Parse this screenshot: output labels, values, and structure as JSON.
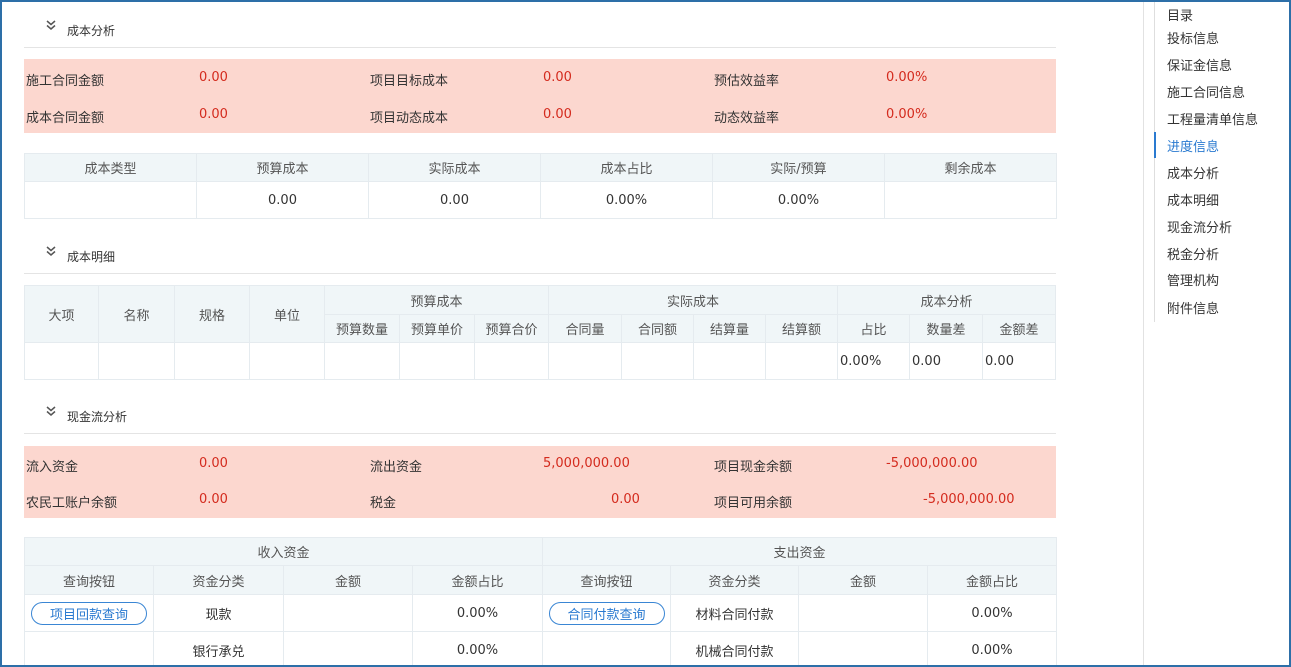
{
  "sections": {
    "cost_analysis": "成本分析",
    "cost_detail": "成本明细",
    "cash_flow": "现金流分析"
  },
  "cost_summary": {
    "row1": [
      {
        "label": "施工合同金额",
        "value": "0.00"
      },
      {
        "label": "项目目标成本",
        "value": "0.00"
      },
      {
        "label": "预估效益率",
        "value": "0.00%"
      }
    ],
    "row2": [
      {
        "label": "成本合同金额",
        "value": "0.00"
      },
      {
        "label": "项目动态成本",
        "value": "0.00"
      },
      {
        "label": "动态效益率",
        "value": "0.00%"
      }
    ]
  },
  "cost_table": {
    "headers": [
      "成本类型",
      "预算成本",
      "实际成本",
      "成本占比",
      "实际/预算",
      "剩余成本"
    ],
    "row": [
      "",
      "0.00",
      "0.00",
      "0.00%",
      "0.00%",
      ""
    ]
  },
  "detail_table": {
    "group_headers": {
      "major": "大项",
      "name": "名称",
      "spec": "规格",
      "unit": "单位",
      "budget": "预算成本",
      "actual": "实际成本",
      "analysis": "成本分析"
    },
    "sub_headers": [
      "预算数量",
      "预算单价",
      "预算合价",
      "合同量",
      "合同额",
      "结算量",
      "结算额",
      "占比",
      "数量差",
      "金额差"
    ],
    "row": [
      "",
      "",
      "",
      "",
      "",
      "",
      "",
      "",
      "",
      "",
      "",
      "0.00%",
      "0.00",
      "0.00"
    ]
  },
  "cash_summary": {
    "row1": [
      {
        "label": "流入资金",
        "value": "0.00"
      },
      {
        "label": "流出资金",
        "value": "5,000,000.00"
      },
      {
        "label": "项目现金余额",
        "value": "-5,000,000.00"
      }
    ],
    "row2": [
      {
        "label": "农民工账户余额",
        "value": "0.00"
      },
      {
        "label": "税金",
        "value": "0.00"
      },
      {
        "label": "项目可用余额",
        "value": "-5,000,000.00"
      }
    ]
  },
  "cash_table": {
    "income_title": "收入资金",
    "expense_title": "支出资金",
    "headers": [
      "查询按钮",
      "资金分类",
      "金额",
      "金额占比",
      "查询按钮",
      "资金分类",
      "金额",
      "金额占比"
    ],
    "income_button": "项目回款查询",
    "expense_button": "合同付款查询",
    "rows": [
      {
        "income_cat": "现款",
        "income_amount": "",
        "income_ratio": "0.00%",
        "expense_cat": "材料合同付款",
        "expense_amount": "",
        "expense_ratio": "0.00%"
      },
      {
        "income_cat": "银行承兑",
        "income_amount": "",
        "income_ratio": "0.00%",
        "expense_cat": "机械合同付款",
        "expense_amount": "",
        "expense_ratio": "0.00%"
      }
    ]
  },
  "sidebar": {
    "title": "目录",
    "items": [
      "投标信息",
      "保证金信息",
      "施工合同信息",
      "工程量清单信息",
      "进度信息",
      "成本分析",
      "成本明细",
      "现金流分析",
      "税金分析",
      "管理机构",
      "附件信息"
    ],
    "active_index": 4
  },
  "colors": {
    "accent": "#2a7ad0",
    "alert_bg": "#fcd7cf",
    "value_red": "#d42b1e",
    "header_bg": "#f0f6f8"
  }
}
